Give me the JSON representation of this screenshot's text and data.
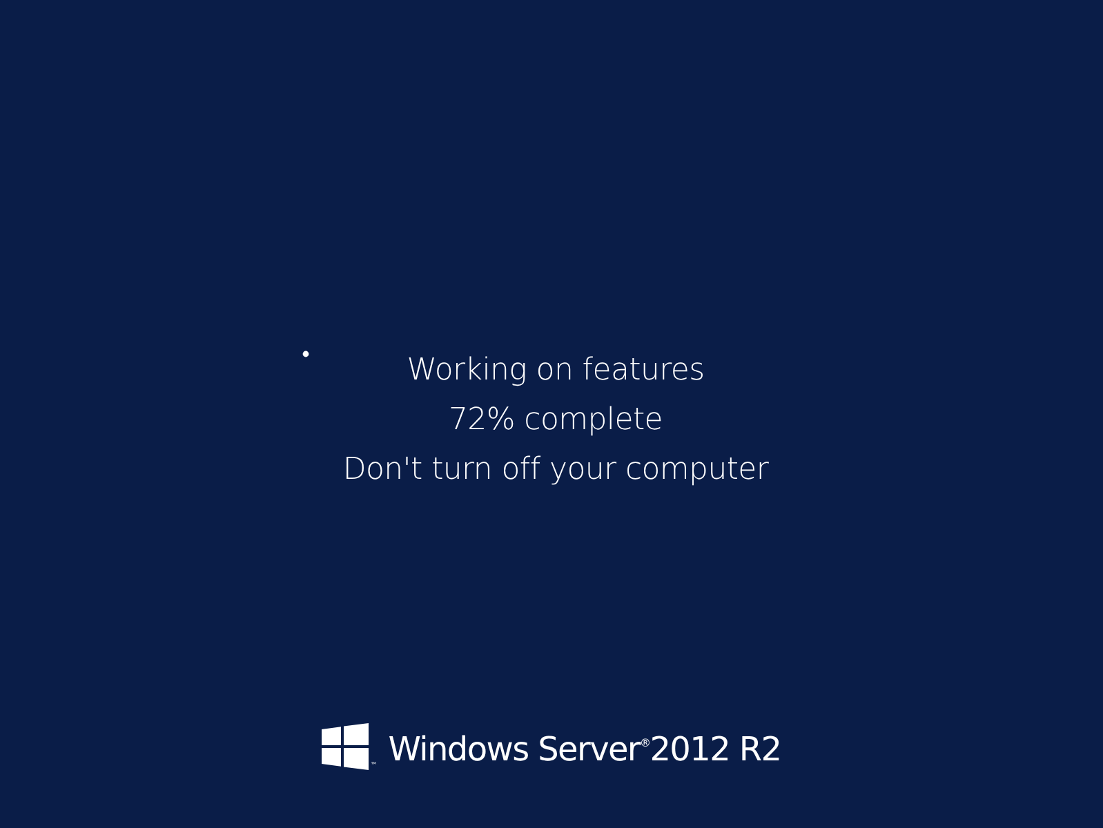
{
  "status": {
    "lines": [
      "Working on features",
      "72% complete",
      "Don't turn off your computer"
    ]
  },
  "branding": {
    "product": "Windows Server$^{®}$2012 R2",
    "trademark": "™"
  }
}
